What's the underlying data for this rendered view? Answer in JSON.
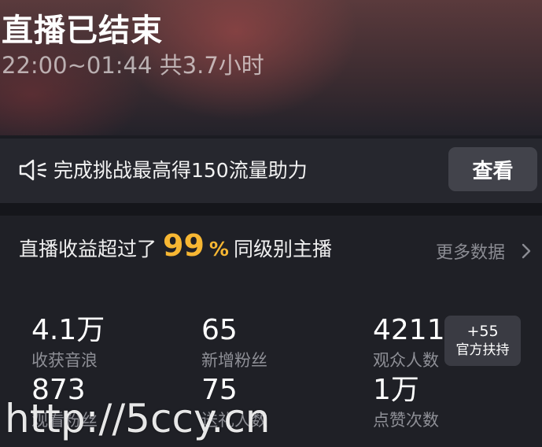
{
  "header": {
    "title": "直播已结束",
    "time_range": "22:00~01:44 共3.7小时"
  },
  "challenge_banner": {
    "icon": "speaker-icon",
    "text": "完成挑战最高得150流量助力",
    "button_label": "查看"
  },
  "summary": {
    "prefix": "直播收益超过了",
    "percent_value": "99",
    "percent_sign": "%",
    "suffix": "同级别主播",
    "more_label": "更多数据"
  },
  "stats": [
    {
      "value": "4.1万",
      "label": "收获音浪"
    },
    {
      "value": "65",
      "label": "新增粉丝"
    },
    {
      "value": "4211",
      "label": "观众人数"
    },
    {
      "value": "873",
      "label": "观看粉丝"
    },
    {
      "value": "75",
      "label": "送礼人数"
    },
    {
      "value": "1万",
      "label": "点赞次数"
    }
  ],
  "official_badge": {
    "count": "+55",
    "label": "官方扶持"
  },
  "watermark": "http://5ccy.cn",
  "colors": {
    "accent": "#f7b733",
    "background": "#1f2026",
    "button": "#42434b"
  }
}
